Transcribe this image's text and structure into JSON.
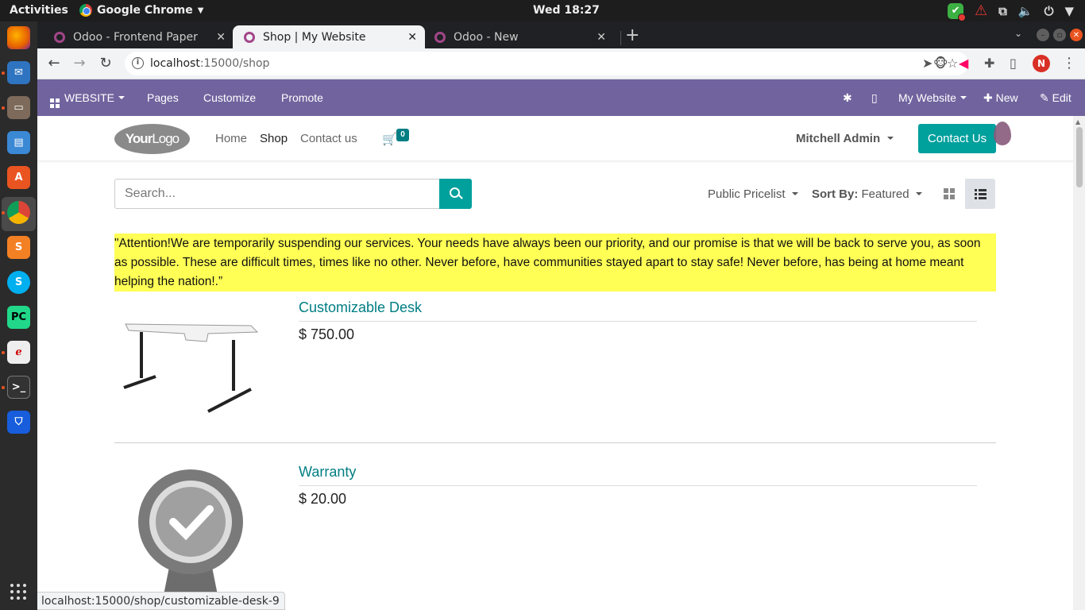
{
  "system": {
    "activities": "Activities",
    "app_name": "Google Chrome",
    "clock": "Wed 18:27"
  },
  "tabs": [
    {
      "title": "Odoo - Frontend Paper",
      "active": false
    },
    {
      "title": "Shop | My Website",
      "active": true
    },
    {
      "title": "Odoo - New",
      "active": false
    }
  ],
  "address": {
    "host": "localhost",
    "path": ":15000/shop"
  },
  "profile_initial": "N",
  "odoo_bar": {
    "website": "WEBSITE",
    "pages": "Pages",
    "customize": "Customize",
    "promote": "Promote",
    "my_website": "My Website",
    "new": "New",
    "edit": "Edit"
  },
  "site": {
    "logo_bold": "Your",
    "logo_light": "Logo",
    "nav": {
      "home": "Home",
      "shop": "Shop",
      "contact": "Contact us"
    },
    "cart_count": "0",
    "user": "Mitchell Admin",
    "contact_button": "Contact Us",
    "search_placeholder": "Search...",
    "pricelist": "Public Pricelist",
    "sort_label": "Sort By:",
    "sort_value": "Featured",
    "notice": "\"Attention!We are temporarily suspending our services. Your needs have always been our priority, and our promise is that we will be back to serve you, as soon as possible. These are difficult times, times like no other. Never before, have communities stayed apart to stay safe! Never before, has being at home meant helping the nation!.”"
  },
  "products": [
    {
      "name": "Customizable Desk",
      "price": "$ 750.00"
    },
    {
      "name": "Warranty",
      "price": "$ 20.00"
    }
  ],
  "status_url": "localhost:15000/shop/customizable-desk-9",
  "colors": {
    "odoo_purple": "#71639e",
    "teal": "#00a09d",
    "link_teal": "#017e84",
    "notice_yellow": "#ffff55"
  }
}
